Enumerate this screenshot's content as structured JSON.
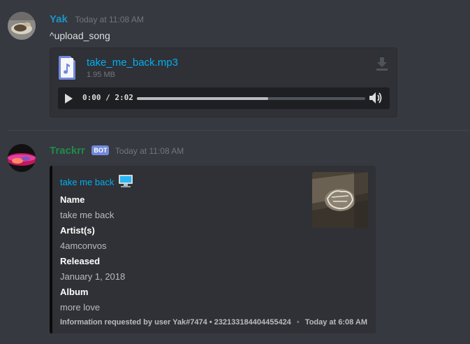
{
  "messages": [
    {
      "author": "Yak",
      "author_color": "#1e92c3",
      "timestamp": "Today at 11:08 AM",
      "content": "^upload_song",
      "attachment": {
        "filename": "take_me_back.mp3",
        "size": "1.95 MB",
        "player": {
          "time": "0:00 / 2:02",
          "progress": 0.0
        }
      }
    },
    {
      "author": "Trackrr",
      "author_color": "#1f8b4c",
      "bot_tag": "BOT",
      "timestamp": "Today at 11:08 AM",
      "embed": {
        "title": "take me back",
        "fields": [
          {
            "name": "Name",
            "value": "take me back"
          },
          {
            "name": "Artist(s)",
            "value": "4amconvos"
          },
          {
            "name": "Released",
            "value": "January 1, 2018"
          },
          {
            "name": "Album",
            "value": "more love"
          }
        ],
        "footer_text": "Information requested by user Yak#7474 • 232133184404455424",
        "footer_separator": "•",
        "footer_time": "Today at 6:08 AM"
      }
    }
  ]
}
